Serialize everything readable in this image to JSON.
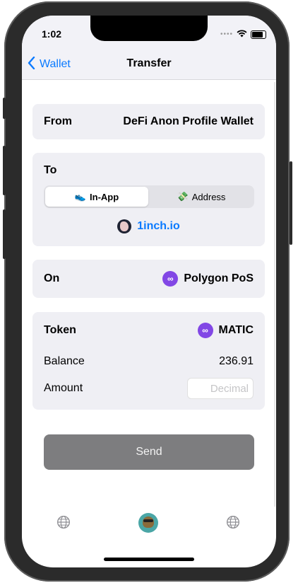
{
  "status_bar": {
    "time": "1:02"
  },
  "nav": {
    "back_label": "Wallet",
    "title": "Transfer"
  },
  "from_card": {
    "label": "From",
    "value": "DeFi Anon Profile Wallet"
  },
  "to_card": {
    "label": "To",
    "segments": [
      {
        "label": "In-App",
        "icon": "shoe-icon",
        "selected": true
      },
      {
        "label": "Address",
        "icon": "money-icon",
        "selected": false
      }
    ],
    "destination": "1inch.io",
    "destination_icon": "1inch-unicorn-icon"
  },
  "network_card": {
    "label": "On",
    "value": "Polygon PoS",
    "icon": "polygon-icon"
  },
  "token_card": {
    "label": "Token",
    "token": "MATIC",
    "balance_label": "Balance",
    "balance": "236.91",
    "amount_label": "Amount",
    "amount_placeholder": "Decimal"
  },
  "send_button": {
    "label": "Send"
  },
  "tab_bar": {
    "icons": [
      "globe-icon",
      "profile-avatar",
      "globe-icon"
    ]
  },
  "colors": {
    "accent": "#0a7aff",
    "polygon": "#8247e5",
    "send_disabled": "#7d7d7f",
    "card_bg": "#efeff4"
  }
}
